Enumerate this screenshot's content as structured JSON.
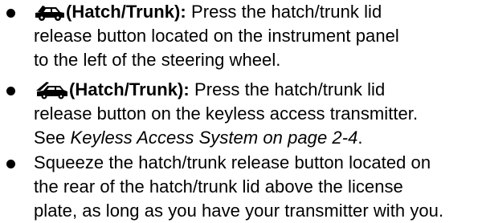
{
  "items": [
    {
      "icon": "car-hatch-open-icon",
      "label": "(Hatch/Trunk):",
      "line1_rest": " Press the hatch/trunk lid",
      "line2": "release button located on the instrument panel",
      "line3": "to the left of the steering wheel."
    },
    {
      "icon": "keyfob-trunk-icon",
      "label": "(Hatch/Trunk):",
      "line1_rest": " Press the hatch/trunk lid",
      "line2": "release button on the keyless access transmitter.",
      "line3_prefix": "See ",
      "line3_italic": "Keyless Access System on page 2-4",
      "line3_suffix": "."
    },
    {
      "line1": "Squeeze the hatch/trunk release button located on",
      "line2": "the rear of the hatch/trunk lid above the license",
      "line3": "plate, as long as you have your transmitter with you."
    }
  ]
}
